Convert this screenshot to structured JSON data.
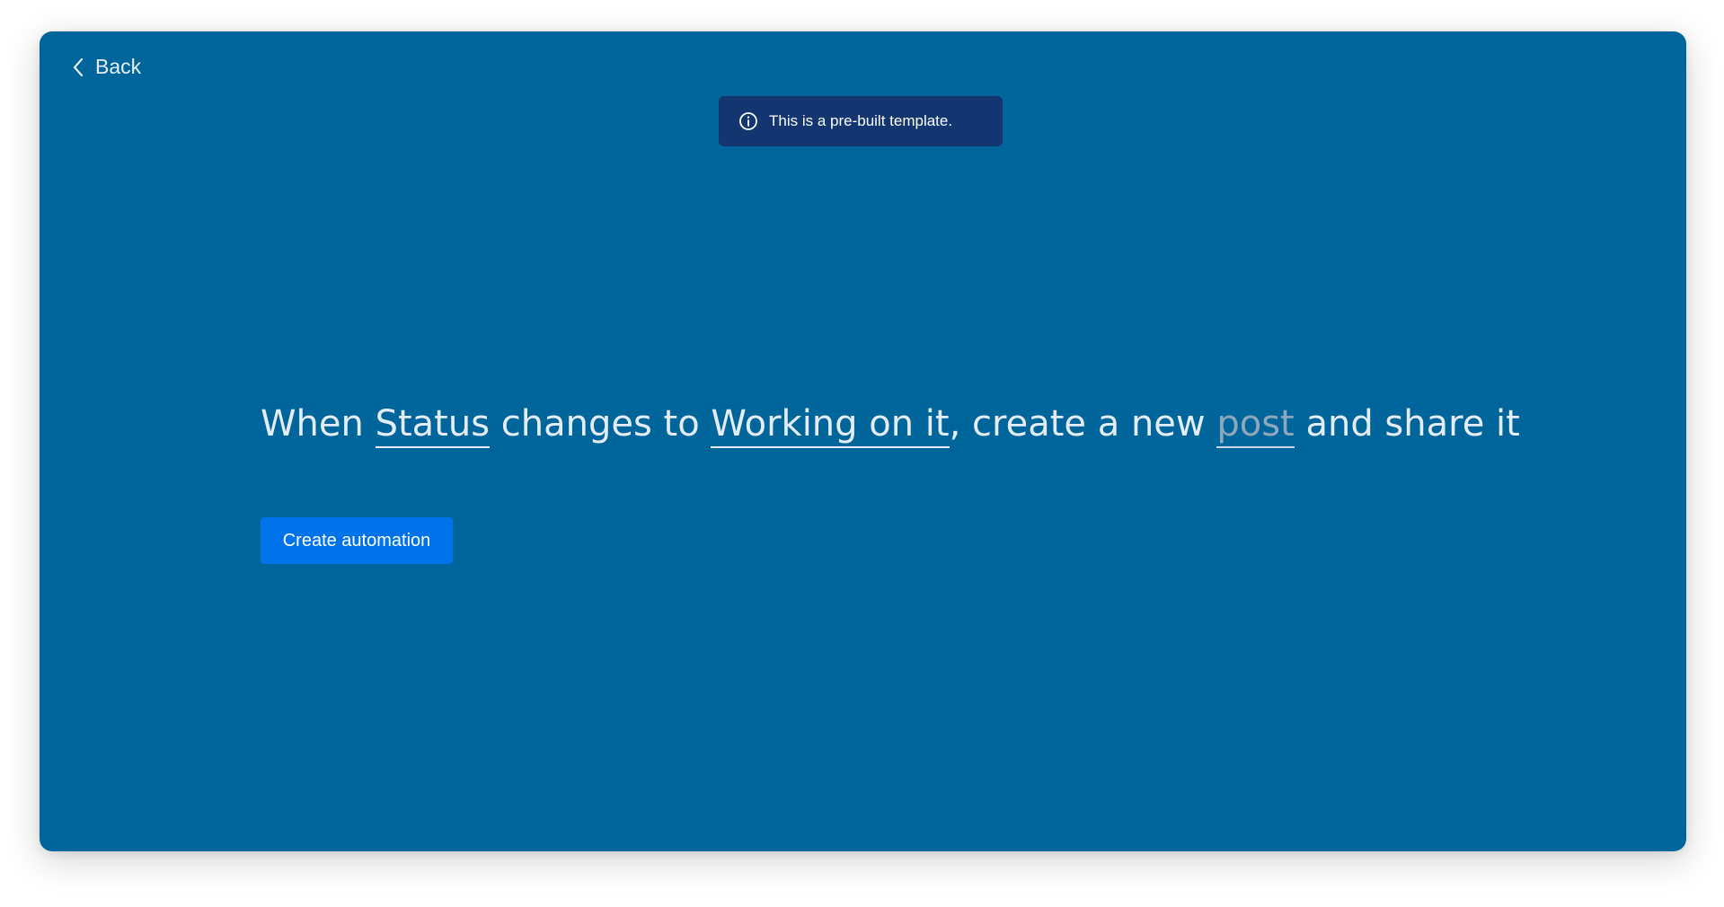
{
  "nav": {
    "back_label": "Back"
  },
  "notice": {
    "icon": "info-icon",
    "text": "This is a pre-built template."
  },
  "recipe": {
    "part1": "When ",
    "trigger_field": "Status",
    "part2": " changes to ",
    "value_field": "Working on it",
    "part3": ", create a new ",
    "item_field": "post",
    "part4": " and share it"
  },
  "actions": {
    "create_label": "Create automation"
  },
  "colors": {
    "background": "#00659b",
    "notice_bg": "#133670",
    "primary_button": "#0073ea",
    "placeholder_text": "#8ea7bd"
  }
}
